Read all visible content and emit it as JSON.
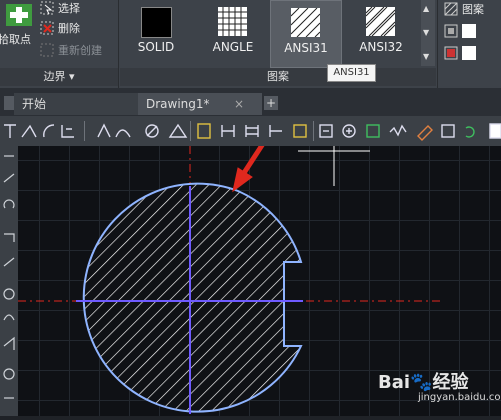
{
  "ribbon": {
    "pick_points_label": "拾取点",
    "select_label": "选择",
    "delete_label": "删除",
    "recreate_label": "重新创建",
    "boundaries_panel_label": "边界",
    "pattern_panel_label": "图案",
    "patterns": [
      "SOLID",
      "ANGLE",
      "ANSI31",
      "ANSI32"
    ],
    "properties_label": "图案"
  },
  "tooltip": {
    "text": "ANSI31"
  },
  "tabs": {
    "start_label": "开始",
    "drawing_label": "Drawing1*"
  },
  "watermark": {
    "brand": "Bai",
    "brand2": "经验",
    "url": "jingyan.baidu.com"
  },
  "colors": {
    "accent_red": "#e0281e",
    "selection_blue": "#8fb4ff",
    "hatch_white": "#ffffff"
  }
}
